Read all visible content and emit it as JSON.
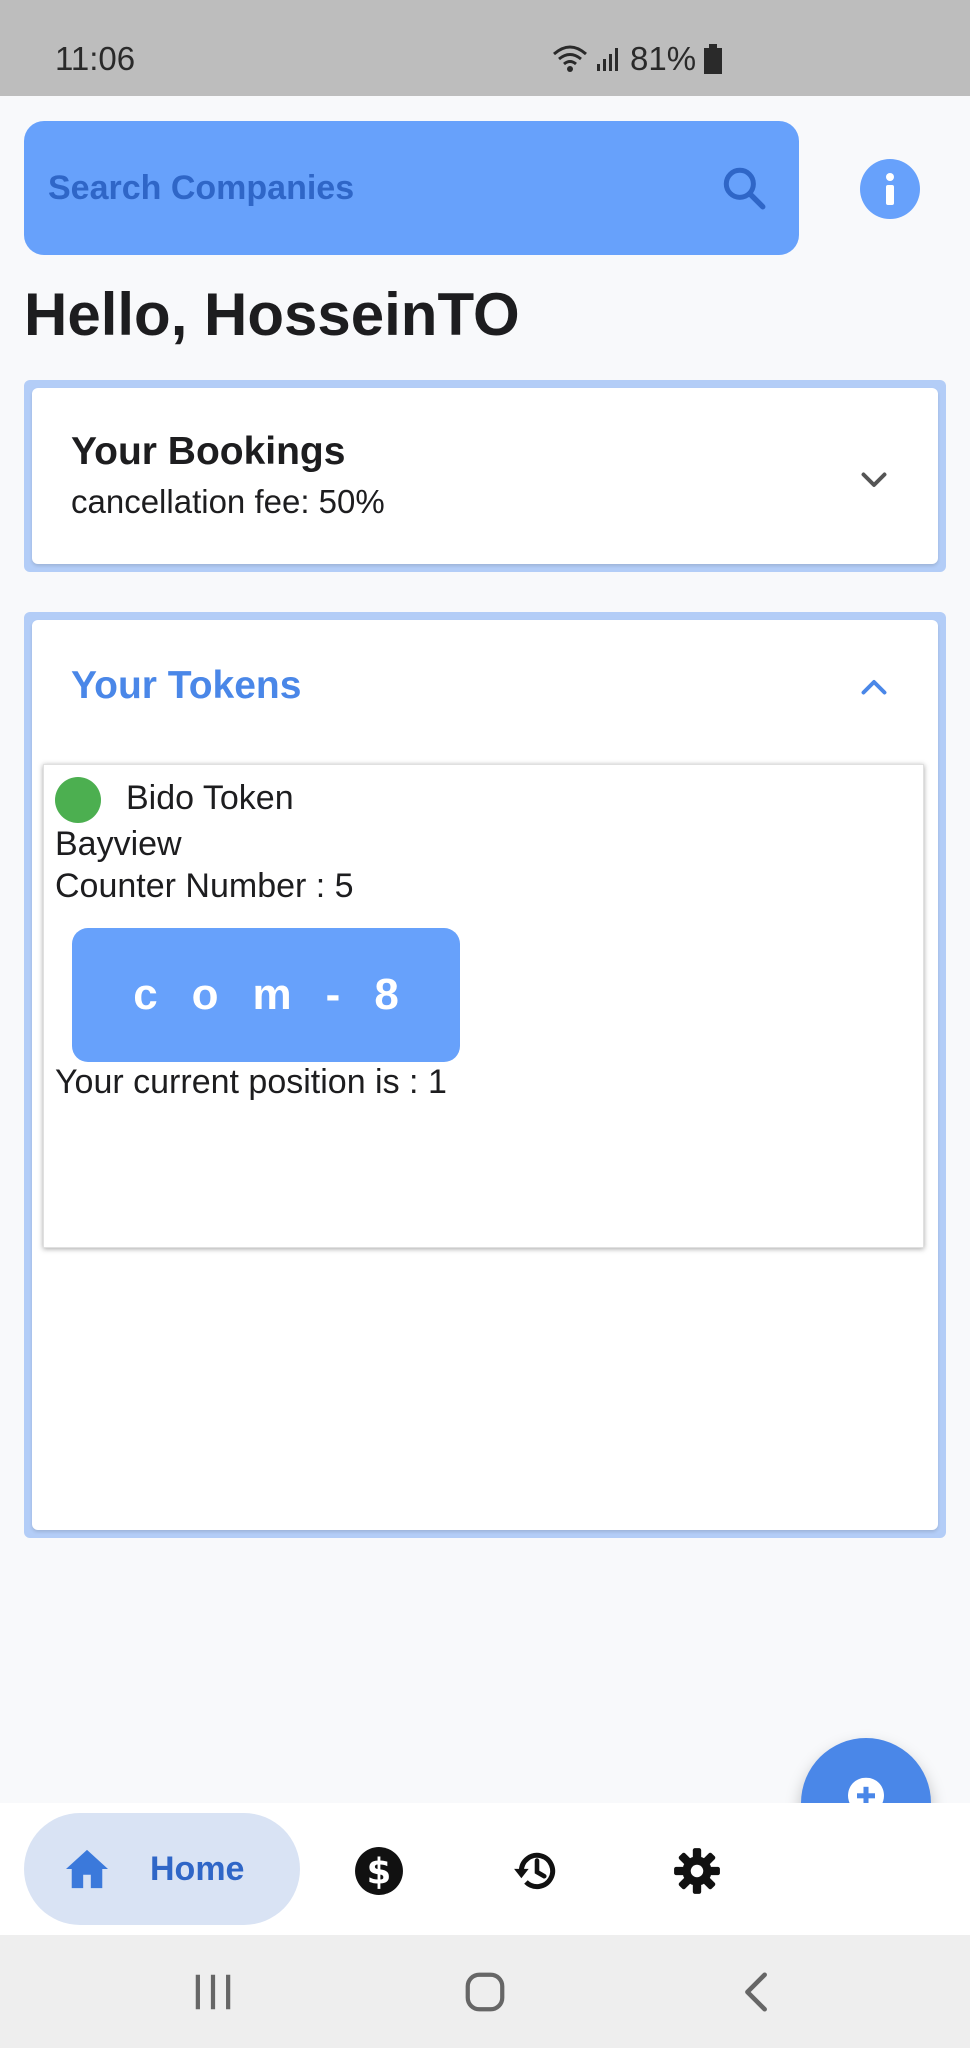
{
  "status_bar": {
    "time": "11:06",
    "battery": "81%"
  },
  "search": {
    "placeholder": "Search Companies"
  },
  "greeting": "Hello, HosseinTO",
  "bookings": {
    "title": "Your Bookings",
    "subtitle": "cancellation fee: 50%"
  },
  "tokens": {
    "title": "Your Tokens",
    "items": [
      {
        "name": "Bido Token",
        "location": "Bayview",
        "counter": "Counter Number : 5",
        "code": "com-8",
        "position": "Your current position is : 1",
        "status_color": "#4CAF50"
      }
    ]
  },
  "bottom_nav": {
    "home_label": "Home",
    "items": [
      "home-icon",
      "dollar-icon",
      "history-icon",
      "settings-icon"
    ]
  },
  "colors": {
    "accent": "#4A87E8",
    "search_bg": "#67A1FB",
    "panel_border": "#B3CDF7",
    "status_green": "#4CAF50"
  }
}
